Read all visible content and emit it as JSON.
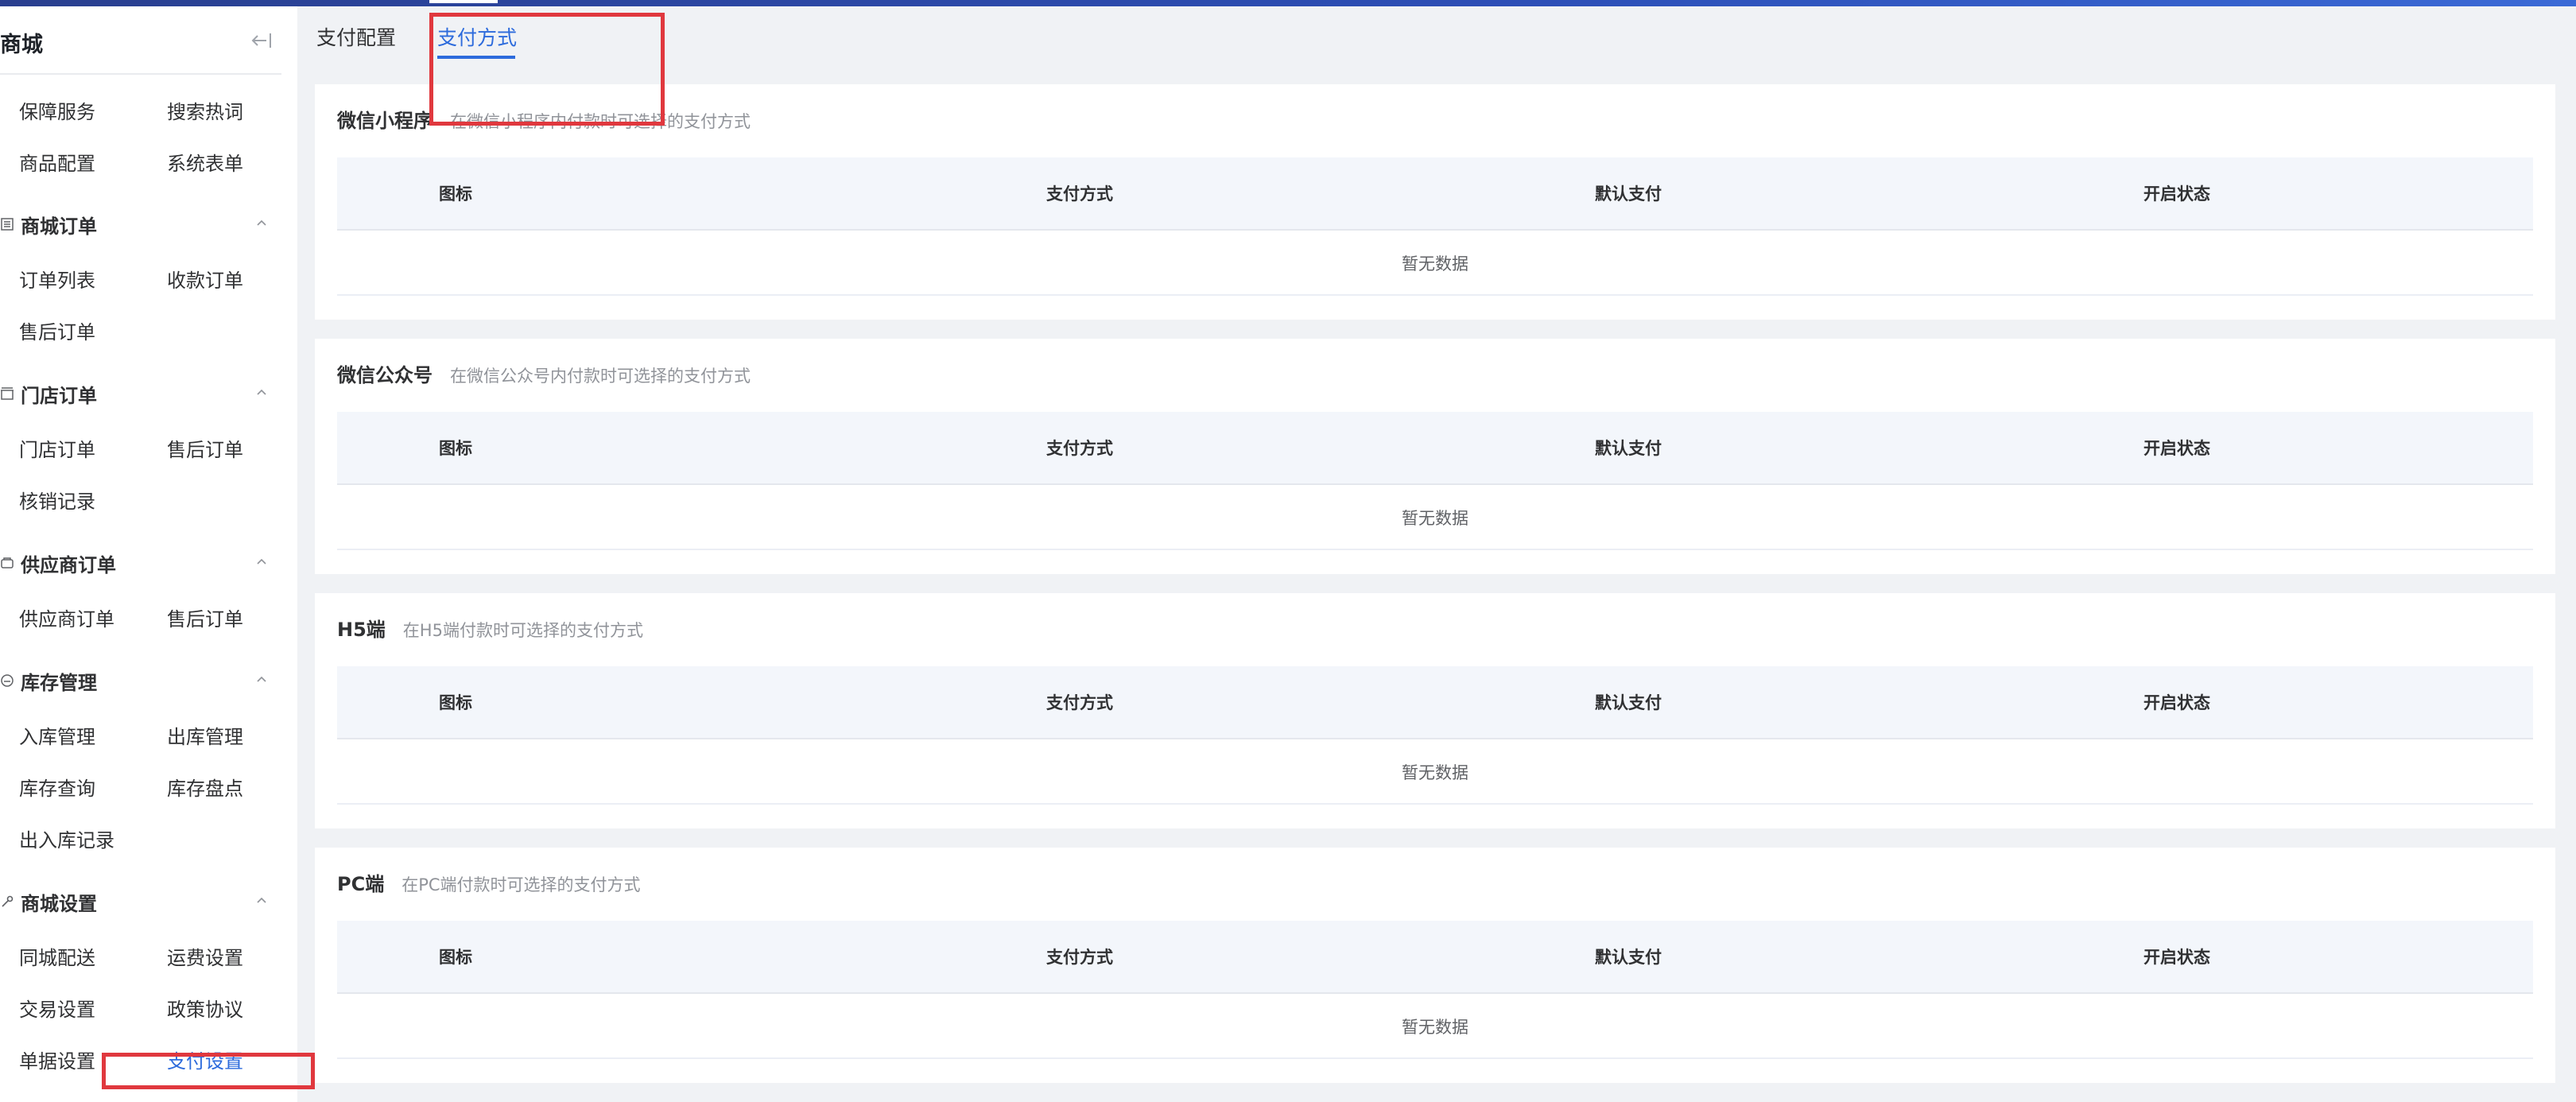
{
  "sidebar": {
    "title": "商城",
    "top_items": [
      "保障服务",
      "搜索热词",
      "商品配置",
      "系统表单"
    ],
    "groups": [
      {
        "title": "商城订单",
        "icon": "list-icon",
        "items": [
          "订单列表",
          "收款订单",
          "售后订单"
        ]
      },
      {
        "title": "门店订单",
        "icon": "store-icon",
        "items": [
          "门店订单",
          "售后订单",
          "核销记录"
        ]
      },
      {
        "title": "供应商订单",
        "icon": "box-icon",
        "items": [
          "供应商订单",
          "售后订单"
        ]
      },
      {
        "title": "库存管理",
        "icon": "stock-icon",
        "items": [
          "入库管理",
          "出库管理",
          "库存查询",
          "库存盘点",
          "出入库记录"
        ]
      },
      {
        "title": "商城设置",
        "icon": "wrench-icon",
        "items": [
          "同城配送",
          "运费设置",
          "交易设置",
          "政策协议",
          "单据设置",
          "支付设置"
        ]
      }
    ],
    "active_item": "支付设置"
  },
  "tabs": [
    {
      "label": "支付配置",
      "active": false
    },
    {
      "label": "支付方式",
      "active": true
    }
  ],
  "table_headers": [
    "图标",
    "支付方式",
    "默认支付",
    "开启状态"
  ],
  "empty_text": "暂无数据",
  "sections": [
    {
      "title": "微信小程序",
      "desc": "在微信小程序内付款时可选择的支付方式"
    },
    {
      "title": "微信公众号",
      "desc": "在微信公众号内付款时可选择的支付方式"
    },
    {
      "title": "H5端",
      "desc": "在H5端付款时可选择的支付方式"
    },
    {
      "title": "PC端",
      "desc": "在PC端付款时可选择的支付方式"
    }
  ],
  "colors": {
    "accent": "#2d6bdc",
    "highlight": "#e0383e",
    "topbar": "#2a3f8f"
  }
}
